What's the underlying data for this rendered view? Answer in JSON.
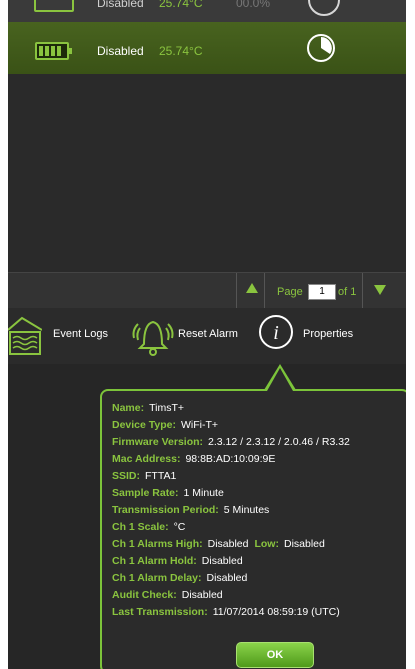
{
  "device_row": {
    "partial": {
      "status": "Disabled",
      "temp": "25.74°C",
      "extra": "00.0%"
    },
    "selected": {
      "status": "Disabled",
      "temp": "25.74°C"
    }
  },
  "pager": {
    "page_label": "Page",
    "page_value": "1",
    "of_label": "of 1"
  },
  "toolbar": {
    "event_logs": "Event Logs",
    "reset_alarm": "Reset Alarm",
    "properties": "Properties"
  },
  "properties": {
    "name": {
      "label": "Name:",
      "value": "TimsT+"
    },
    "device_type": {
      "label": "Device Type:",
      "value": "WiFi-T+"
    },
    "firmware": {
      "label": "Firmware Version:",
      "value": "2.3.12 / 2.3.12 / 2.0.46 / R3.32"
    },
    "mac": {
      "label": "Mac Address:",
      "value": "98:8B:AD:10:09:9E"
    },
    "ssid": {
      "label": "SSID:",
      "value": "FTTA1"
    },
    "sample_rate": {
      "label": "Sample Rate:",
      "value": "1 Minute"
    },
    "transmission_period": {
      "label": "Transmission Period:",
      "value": "5 Minutes"
    },
    "ch1_scale": {
      "label": "Ch 1 Scale:",
      "value": "°C"
    },
    "ch1_alarms_high": {
      "label": "Ch 1 Alarms High:",
      "value": "Disabled",
      "low_label": "Low:",
      "low_value": "Disabled"
    },
    "ch1_alarm_hold": {
      "label": "Ch 1 Alarm Hold:",
      "value": "Disabled"
    },
    "ch1_alarm_delay": {
      "label": "Ch 1 Alarm Delay:",
      "value": "Disabled"
    },
    "audit_check": {
      "label": "Audit Check:",
      "value": "Disabled"
    },
    "last_transmission": {
      "label": "Last Transmission:",
      "value": "11/07/2014 08:59:19 (UTC)"
    }
  },
  "ok_label": "OK",
  "colors": {
    "accent": "#8ac43f",
    "panel": "#2b2b2b",
    "selected_row": "#48631f"
  },
  "icons": [
    "battery-icon",
    "pie-chart-icon",
    "arrow-up-icon",
    "arrow-down-icon",
    "event-logs-icon",
    "bell-icon",
    "info-icon"
  ]
}
